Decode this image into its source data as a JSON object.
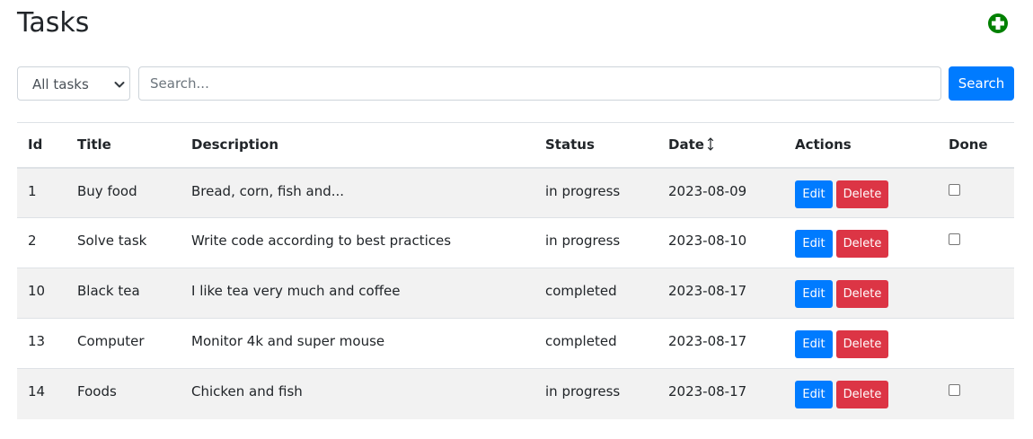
{
  "header": {
    "title": "Tasks",
    "add_icon": "plus-circle-icon",
    "add_icon_color": "#008000"
  },
  "filters": {
    "status_select": {
      "selected": "All tasks"
    },
    "search": {
      "placeholder": "Search...",
      "value": ""
    },
    "search_button_label": "Search"
  },
  "table": {
    "columns": {
      "id": "Id",
      "title": "Title",
      "description": "Description",
      "status": "Status",
      "date": "Date",
      "actions": "Actions",
      "done": "Done"
    },
    "sort_icon": "sort-arrows-icon",
    "edit_label": "Edit",
    "delete_label": "Delete",
    "rows": [
      {
        "id": "1",
        "title": "Buy food",
        "description": "Bread, corn, fish and...",
        "status": "in progress",
        "date": "2023-08-09",
        "done_checkbox": true,
        "done_checked": false
      },
      {
        "id": "2",
        "title": "Solve task",
        "description": "Write code according to best practices",
        "status": "in progress",
        "date": "2023-08-10",
        "done_checkbox": true,
        "done_checked": false
      },
      {
        "id": "10",
        "title": "Black tea",
        "description": "I like tea very much and coffee",
        "status": "completed",
        "date": "2023-08-17",
        "done_checkbox": false,
        "done_checked": false
      },
      {
        "id": "13",
        "title": "Computer",
        "description": "Monitor 4k and super mouse",
        "status": "completed",
        "date": "2023-08-17",
        "done_checkbox": false,
        "done_checked": false
      },
      {
        "id": "14",
        "title": "Foods",
        "description": "Chicken and fish",
        "status": "in progress",
        "date": "2023-08-17",
        "done_checkbox": true,
        "done_checked": false
      }
    ]
  },
  "colors": {
    "primary": "#007bff",
    "danger": "#dc3545",
    "stripe": "#f2f2f2",
    "text": "#212529"
  }
}
